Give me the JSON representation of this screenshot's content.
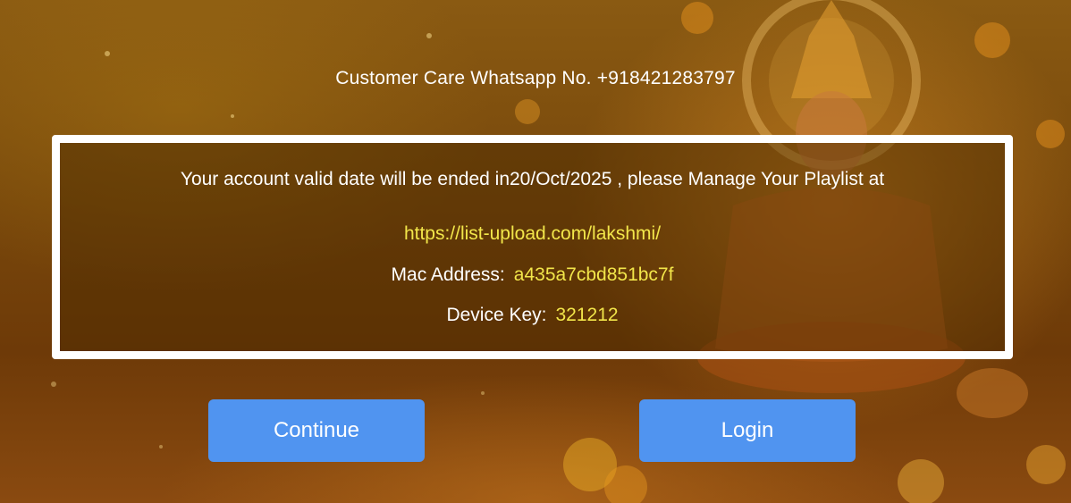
{
  "header": {
    "customer_care": "Customer Care Whatsapp No. +918421283797"
  },
  "info": {
    "validity_message": "Your account valid date will be ended in20/Oct/2025 , please Manage Your Playlist at",
    "playlist_url": "https://list-upload.com/lakshmi/",
    "mac_label": "Mac Address:",
    "mac_value": "a435a7cbd851bc7f",
    "device_key_label": "Device Key:",
    "device_key_value": "321212"
  },
  "buttons": {
    "continue_label": "Continue",
    "login_label": "Login"
  },
  "colors": {
    "button_bg": "#5094f0",
    "highlight_text": "#f2e64a",
    "box_border": "#ffffff"
  }
}
